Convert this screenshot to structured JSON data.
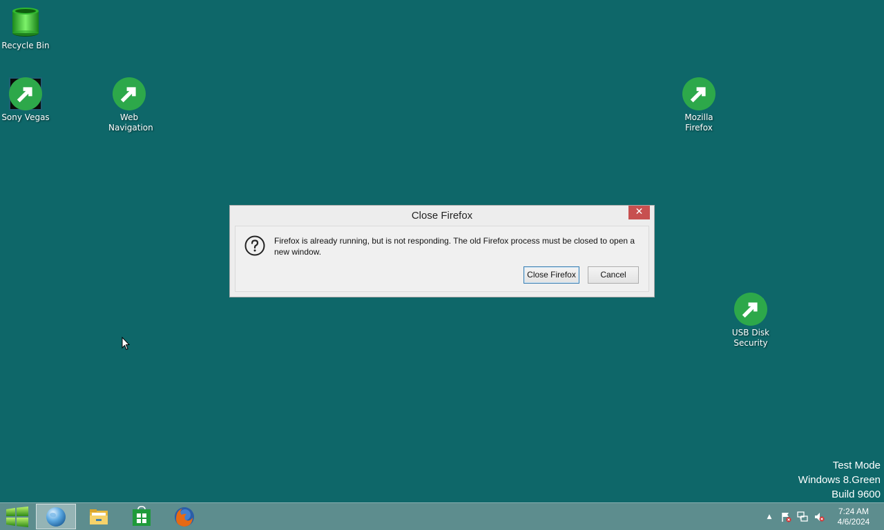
{
  "desktop": {
    "icons": [
      {
        "label": "Recycle Bin"
      },
      {
        "label": "Sony Vegas"
      },
      {
        "label": "Web Navigation"
      },
      {
        "label": "Mozilla Firefox"
      },
      {
        "label": "USB Disk Security"
      }
    ],
    "watermark": {
      "line1": "Test Mode",
      "line2": "Windows 8.Green",
      "line3": "Build 9600"
    }
  },
  "dialog": {
    "title": "Close Firefox",
    "close_glyph": "✕",
    "message": "Firefox is already running, but is not responding. The old Firefox process must be closed to open a new window.",
    "buttons": {
      "close_firefox": "Close Firefox",
      "cancel": "Cancel"
    }
  },
  "taskbar": {
    "clock": {
      "time": "7:24 AM",
      "date": "4/6/2024"
    },
    "tray_overflow_glyph": "▲"
  },
  "colors": {
    "desktop_bg": "#0e6769",
    "taskbar_bg": "#5d8d8e",
    "dialog_close_red": "#c75050",
    "primary_button_border": "#3c7fb1"
  }
}
